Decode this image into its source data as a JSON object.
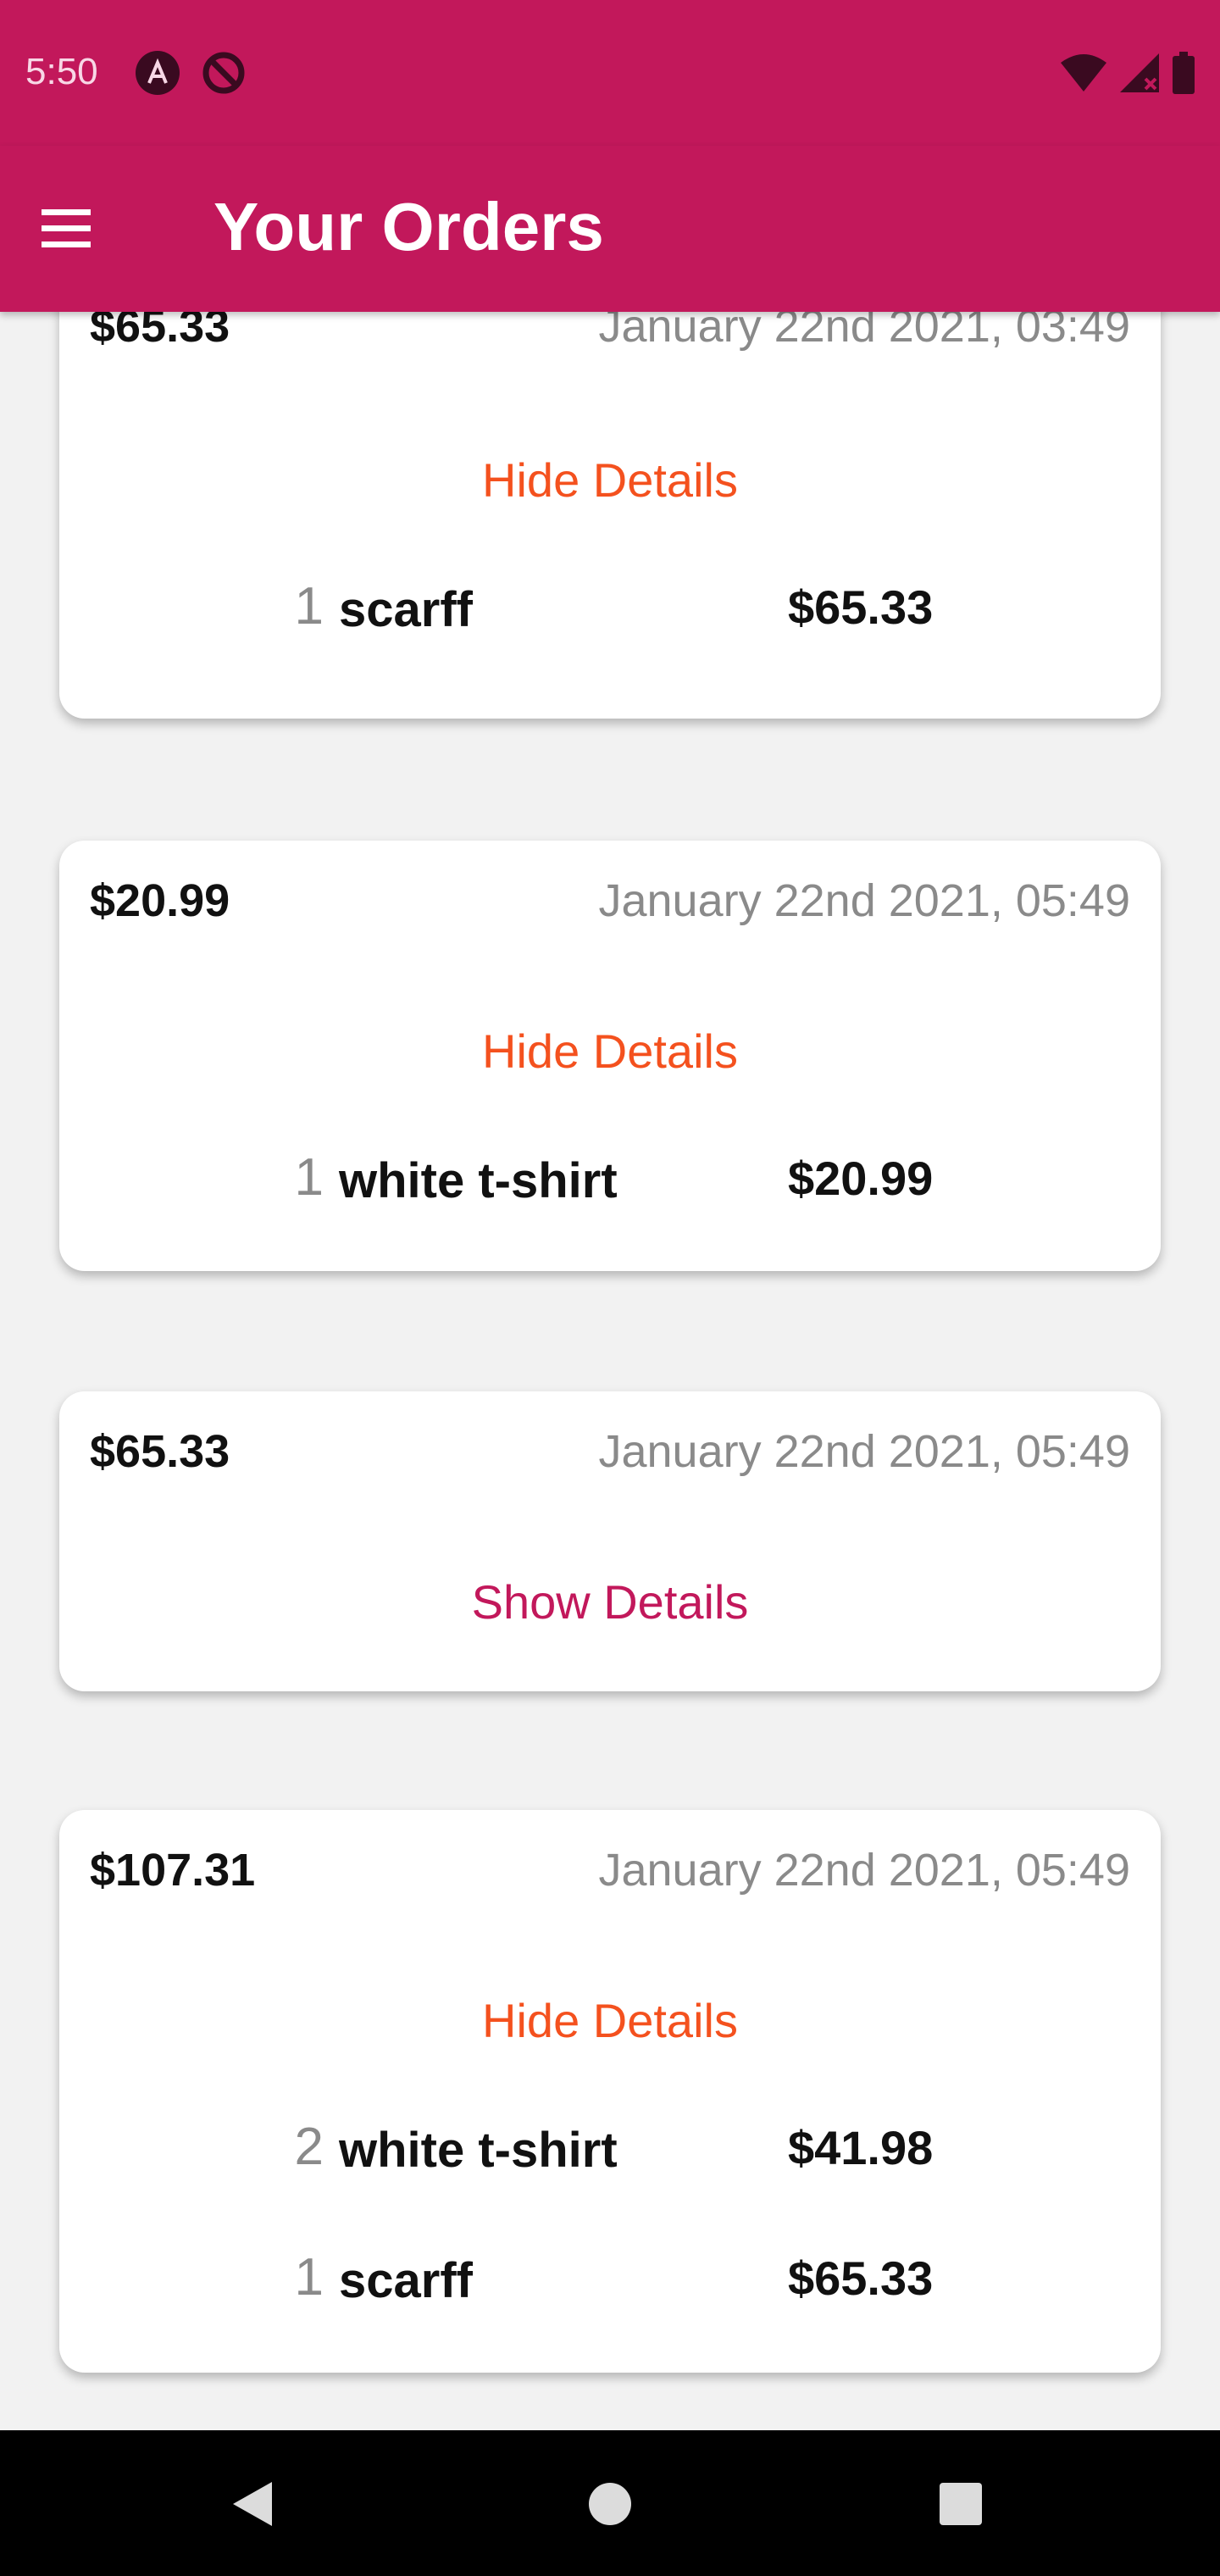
{
  "status_bar": {
    "time": "5:50",
    "icons_left": [
      "app-a-icon",
      "no-sign-icon"
    ],
    "icons_right": [
      "wifi-icon",
      "signal-icon",
      "battery-icon"
    ]
  },
  "app_bar": {
    "title": "Your Orders",
    "menu_icon": "hamburger-menu-icon",
    "color": "#c2185b"
  },
  "orders": [
    {
      "amount": "$65.33",
      "date": "January 22nd 2021, 03:49",
      "toggle_label": "Hide Details",
      "expanded": true,
      "items": [
        {
          "qty": "1",
          "name": "scarff",
          "price": "$65.33"
        }
      ]
    },
    {
      "amount": "$20.99",
      "date": "January 22nd 2021, 05:49",
      "toggle_label": "Hide Details",
      "expanded": true,
      "items": [
        {
          "qty": "1",
          "name": "white t-shirt",
          "price": "$20.99"
        }
      ]
    },
    {
      "amount": "$65.33",
      "date": "January 22nd 2021, 05:49",
      "toggle_label": "Show Details",
      "expanded": false,
      "items": []
    },
    {
      "amount": "$107.31",
      "date": "January 22nd 2021, 05:49",
      "toggle_label": "Hide Details",
      "expanded": true,
      "items": [
        {
          "qty": "2",
          "name": "white t-shirt",
          "price": "$41.98"
        },
        {
          "qty": "1",
          "name": "scarff",
          "price": "$65.33"
        }
      ]
    }
  ],
  "colors": {
    "primary": "#c2185b",
    "hide_details": "#f4511e",
    "show_details": "#c2185b"
  },
  "nav_bar": {
    "icons": [
      "back-icon",
      "home-icon",
      "recents-icon"
    ]
  }
}
